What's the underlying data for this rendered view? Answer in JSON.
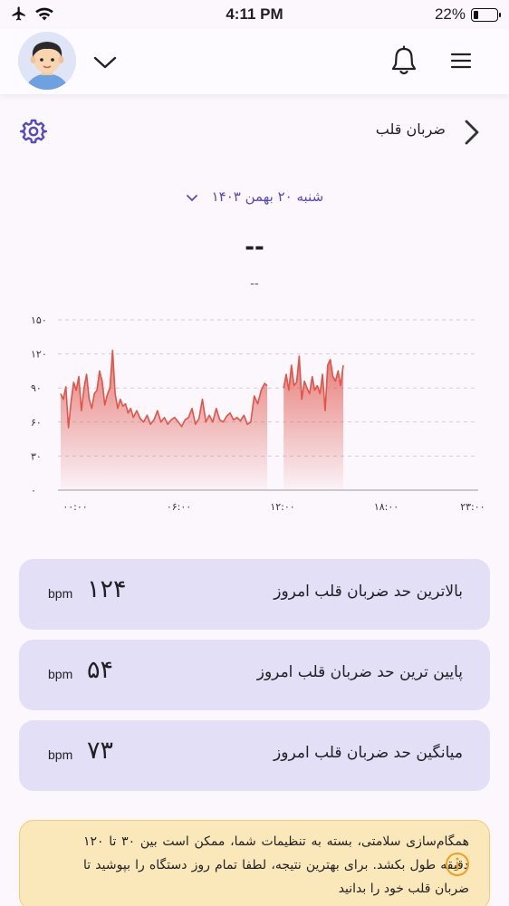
{
  "status_bar": {
    "time": "4:11 PM",
    "battery_text": "22%",
    "battery_level": 0.22,
    "icons": [
      "airplane-icon",
      "wifi-icon",
      "battery-icon"
    ]
  },
  "header": {
    "icons": [
      "avatar",
      "chevron-down-icon",
      "bell-icon",
      "hamburger-menu-icon"
    ]
  },
  "title_row": {
    "title": "ضربان قلب",
    "icons": [
      "gear-icon",
      "chevron-right-icon"
    ]
  },
  "date_selector": {
    "label": "شنبه ۲۰ بهمن ۱۴۰۳"
  },
  "summary": {
    "value": "--",
    "subtext": "--"
  },
  "colors": {
    "accent": "#5a4ab8",
    "line": "#e0544a",
    "card_bg": "#e3dff6",
    "info_bg": "#fbe8ba",
    "info_border": "#f3cc78"
  },
  "chart_data": {
    "type": "area",
    "ylim": [
      0,
      150
    ],
    "y_ticks": [
      "۰",
      "۳۰",
      "۶۰",
      "۹۰",
      "۱۲۰",
      "۱۵۰"
    ],
    "y_tick_values": [
      0,
      30,
      60,
      90,
      120,
      150
    ],
    "xlim": [
      0,
      24
    ],
    "x_ticks": [
      "۰۰:۰۰",
      "۰۶:۰۰",
      "۱۲:۰۰",
      "۱۸:۰۰",
      "۲۳:۰۰"
    ],
    "x_tick_values": [
      0,
      6,
      12,
      18,
      23
    ],
    "grid": true,
    "series": [
      {
        "segments": [
          {
            "x": [
              0,
              0.15,
              0.3,
              0.45,
              0.6,
              0.75,
              0.9,
              1.05,
              1.2,
              1.35,
              1.5,
              1.65,
              1.8,
              1.95,
              2.1,
              2.25,
              2.4,
              2.55,
              2.7,
              2.85,
              3.0,
              3.15,
              3.3,
              3.45,
              3.6,
              3.75,
              3.9,
              4.05,
              4.2,
              4.4,
              4.6,
              4.8,
              5.0,
              5.2,
              5.4,
              5.6,
              5.8,
              6.0,
              6.2,
              6.4,
              6.6,
              6.8,
              7.0,
              7.2,
              7.4,
              7.6,
              7.8,
              8.0,
              8.2,
              8.4,
              8.6,
              8.8,
              9.0,
              9.2,
              9.4,
              9.6,
              9.8,
              10.0,
              10.2,
              10.4,
              10.6,
              10.8,
              11.0,
              11.2,
              11.4,
              11.6,
              11.8,
              11.95
            ],
            "y": [
              85,
              80,
              91,
              55,
              78,
              95,
              88,
              100,
              70,
              90,
              102,
              80,
              72,
              85,
              88,
              105,
              96,
              75,
              84,
              90,
              123,
              85,
              72,
              80,
              74,
              76,
              68,
              72,
              64,
              70,
              63,
              60,
              66,
              58,
              62,
              70,
              60,
              64,
              58,
              62,
              64,
              60,
              56,
              62,
              64,
              72,
              58,
              63,
              80,
              60,
              66,
              60,
              72,
              62,
              60,
              65,
              68,
              62,
              64,
              61,
              66,
              58,
              60,
              83,
              76,
              88,
              94,
              92
            ]
          },
          {
            "x": [
              12.9,
              13.05,
              13.2,
              13.35,
              13.5,
              13.65,
              13.8,
              13.95,
              14.1,
              14.25,
              14.4,
              14.55,
              14.7,
              14.85,
              15.0,
              15.15,
              15.3,
              15.45,
              15.6,
              15.75,
              15.9,
              16.05,
              16.2,
              16.35
            ],
            "y": [
              90,
              102,
              88,
              110,
              92,
              95,
              118,
              80,
              96,
              90,
              85,
              100,
              88,
              92,
              85,
              102,
              70,
              110,
              115,
              100,
              96,
              105,
              92,
              110
            ]
          }
        ]
      }
    ]
  },
  "stats": [
    {
      "label": "بالاترین حد ضربان قلب امروز",
      "value": "۱۲۴",
      "unit": "bpm"
    },
    {
      "label": "پایین ترین حد ضربان قلب امروز",
      "value": "۵۴",
      "unit": "bpm"
    },
    {
      "label": "میانگین حد ضربان قلب امروز",
      "value": "۷۳",
      "unit": "bpm"
    }
  ],
  "info": {
    "text": "همگام‌سازی سلامتی، بسته به تنظیمات شما، ممکن است بین ۳۰ تا ۱۲۰ دقیقه طول بکشد. برای بهترین نتیجه، لطفا تمام روز دستگاه را بپوشید تا ضربان قلب خود را بدانید"
  }
}
